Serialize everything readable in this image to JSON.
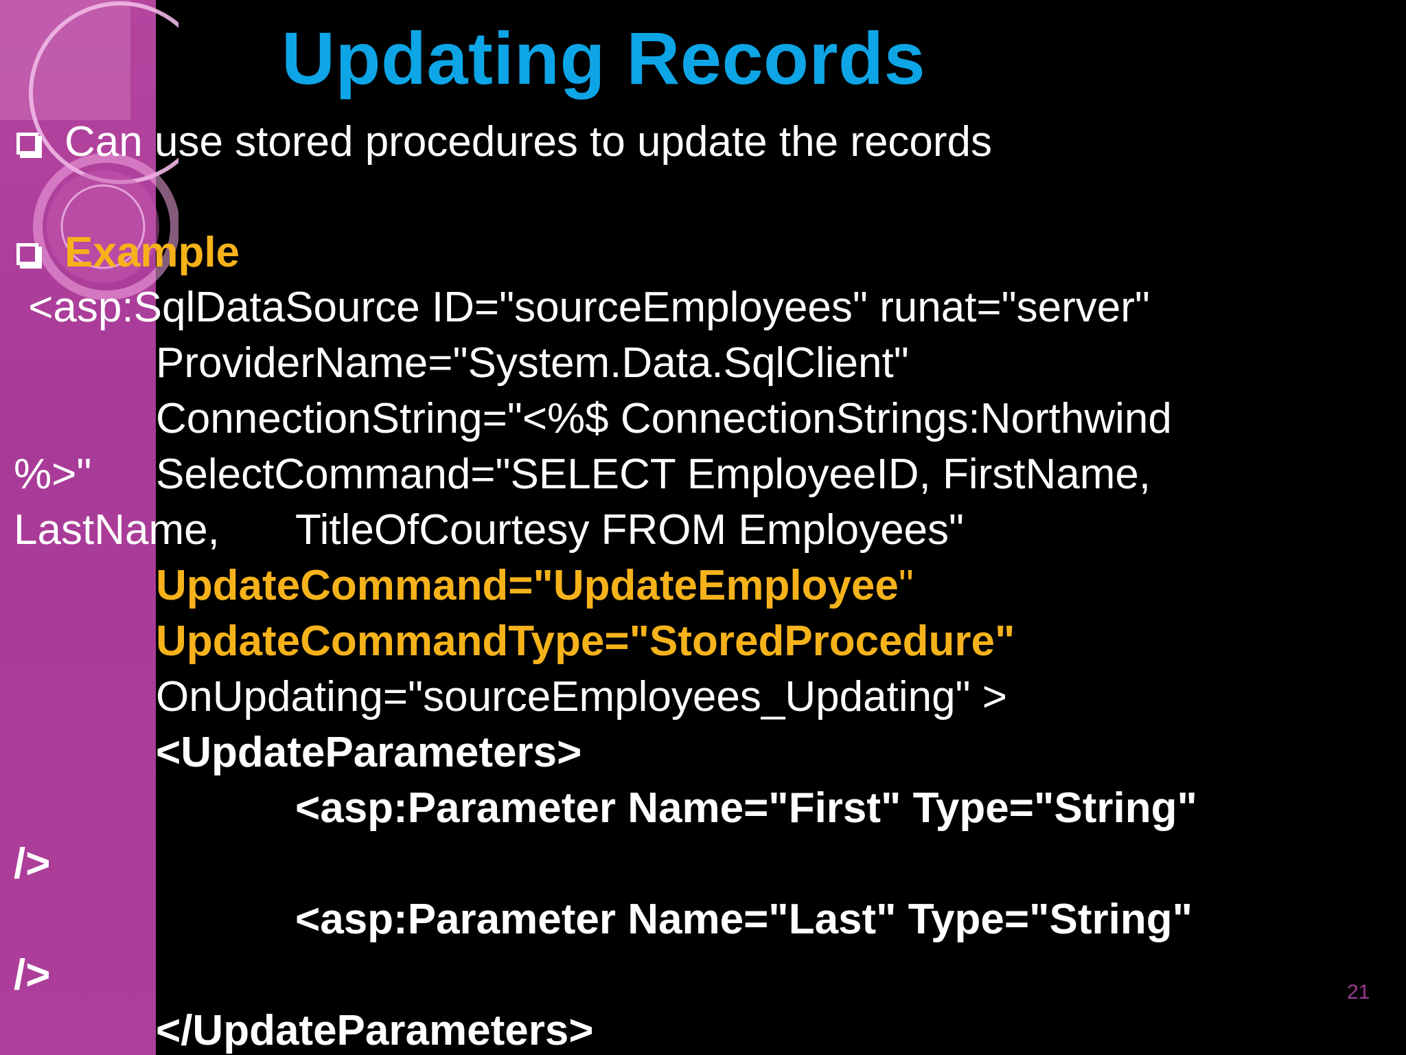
{
  "slide": {
    "title": "Updating Records",
    "bullet1": "Can use stored procedures to update the records",
    "bullet2": "Example",
    "code": [
      " <asp:SqlDataSource ID=\"sourceEmployees\" runat=\"server\"",
      "ProviderName=\"System.Data.SqlClient\"",
      "ConnectionString=\"<%$ ConnectionStrings:Northwind",
      "%>\"",
      "SelectCommand=\"SELECT EmployeeID, FirstName,",
      "LastName,",
      "TitleOfCourtesy FROM Employees\"",
      "UpdateCommand=\"UpdateEmployee",
      "\"",
      "UpdateCommandType=\"StoredProcedure\"",
      "OnUpdating=\"sourceEmployees_Updating\" >",
      "<UpdateParameters>",
      "<asp:Parameter Name=\"First\" Type=\"String\"",
      "/>",
      "<asp:Parameter Name=\"Last\" Type=\"String\"",
      "/>",
      "</UpdateParameters>"
    ],
    "page_number": "21"
  }
}
